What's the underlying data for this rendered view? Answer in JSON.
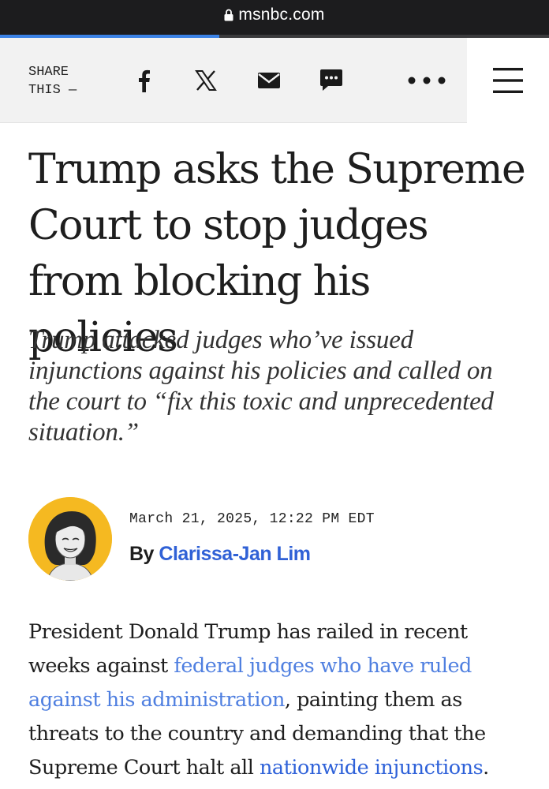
{
  "browser": {
    "url": "msnbc.com",
    "load_progress": 0.4
  },
  "share_bar": {
    "label_line1": "SHARE",
    "label_line2": "THIS —",
    "buttons": [
      "facebook-icon",
      "x-icon",
      "email-icon",
      "sms-icon",
      "more-icon"
    ],
    "menu": "hamburger-menu-icon"
  },
  "article": {
    "headline": "Trump asks the Supreme Court to stop judges from blocking his policies",
    "dek": "Trump attacked judges who’ve issued injunctions against his policies and called on the court to “fix this toxic and unprecedented situation.”",
    "date": "March 21, 2025, 12:22 PM EDT",
    "by": "By",
    "author": "Clarissa-Jan Lim",
    "body": {
      "p1_part1": "President Donald Trump has railed in recent weeks against ",
      "p1_link1": "federal judges who have ruled against his administration",
      "p1_part2": ", painting them as threats to the country and demanding that the Supreme Court halt all ",
      "p1_link2": "nationwide injunctions",
      "p1_part3": "."
    }
  },
  "colors": {
    "url_bar": "#1c1c1e",
    "progress": "#3b82e6",
    "share_bar": "#f2f2f2",
    "author_link": "#3061d6",
    "body_link": "#4f7fe0",
    "avatar_bg": "#f5b921"
  }
}
